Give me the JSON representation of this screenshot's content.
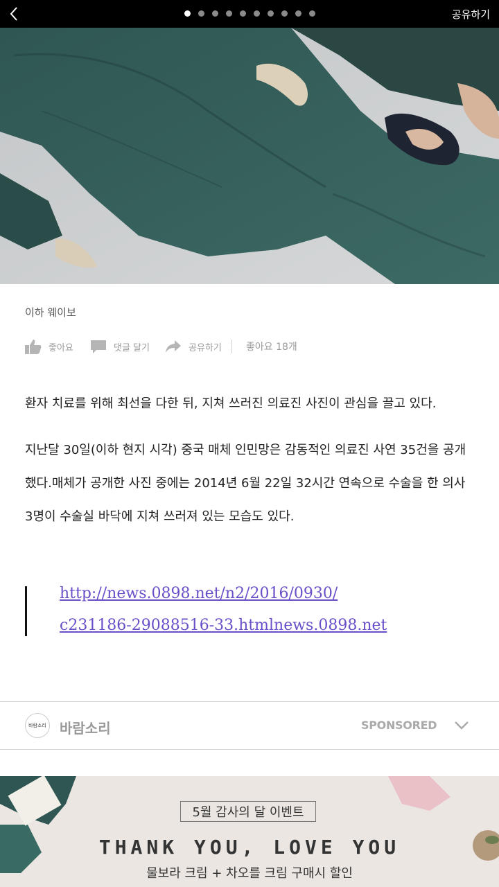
{
  "topbar": {
    "share_label": "공유하기",
    "page_dots": 10,
    "active_dot": 0
  },
  "article": {
    "source": "이하 웨이보",
    "actions": {
      "like_label": "좋아요",
      "comment_label": "댓글 달기",
      "share_label": "공유하기",
      "like_count": "좋아요 18개"
    },
    "paragraph1": "환자 치료를 위해 최선을 다한 뒤, 지쳐 쓰러진 의료진 사진이 관심을 끌고 있다.",
    "paragraph2": "지난달 30일(이하 현지 시각) 중국 매체 인민망은 감동적인 의료진 사연 35건을 공개했다.매체가 공개한 사진 중에는 2014년 6월 22일 32시간 연속으로 수술을 한 의사 3명이 수술실 바닥에 지쳐 쓰러져 있는 모습도 있다.",
    "quote_link_line1": "http://news.0898.net/n2/2016/0930/",
    "quote_link_line2": "c231186-29088516-33.htmlnews.0898.net"
  },
  "sponsored": {
    "logo_text": "바람소리",
    "name": "바람소리",
    "tag": "SPONSORED"
  },
  "ad": {
    "event": "5월 감사의 달 이벤트",
    "headline": "THANK YOU, LOVE YOU",
    "sub": "물보라 크림 + 차오를 크림  구매시 할인"
  },
  "colors": {
    "topbar_bg": "#000000",
    "link": "#6a4fc9",
    "scrubs": "#355f5b",
    "ad_bg": "#ebe6e2"
  }
}
